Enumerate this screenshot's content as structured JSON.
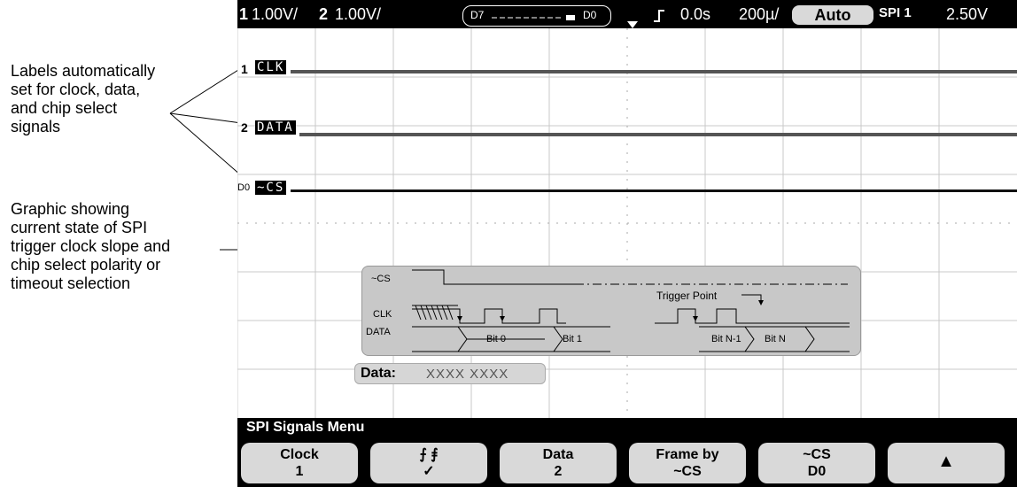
{
  "callouts": {
    "labels": [
      "Labels automatically",
      "set  for clock, data,",
      "and chip select",
      "signals"
    ],
    "graphic": [
      "Graphic showing",
      "current state of SPI",
      "trigger clock slope and",
      "chip select polarity or",
      "timeout selection"
    ]
  },
  "statusbar": {
    "ch1_num": "1",
    "ch1_scale": "1.00V/",
    "ch2_num": "2",
    "ch2_scale": "1.00V/",
    "digital_left": "D7",
    "digital_right": "D0",
    "trigger_glyph": "⨽",
    "delay": "0.0s",
    "timebase": "200µ/",
    "mode": "Auto",
    "trigger_source": "SPI 1",
    "trigger_level": "2.50V"
  },
  "traces": {
    "clk": {
      "marker": "1",
      "label": "CLK"
    },
    "data": {
      "marker": "2",
      "label": "DATA"
    },
    "cs": {
      "marker": "D0",
      "label": "~CS"
    }
  },
  "spi_graphic": {
    "cs_label": "~CS",
    "clk_label": "CLK",
    "data_label": "DATA",
    "trigger_point": "Trigger Point",
    "bits": [
      "Bit 0",
      "Bit 1",
      "Bit N-1",
      "Bit N"
    ]
  },
  "data_box": {
    "label": "Data:",
    "value": "XXXX XXXX"
  },
  "menu": {
    "title": "SPI Signals Menu",
    "softkeys": [
      {
        "line1": "Clock",
        "line2": "1"
      },
      {
        "line1": "⨍   ⨎",
        "line2": "✓"
      },
      {
        "line1": "Data",
        "line2": "2"
      },
      {
        "line1": "Frame by",
        "line2": "~CS"
      },
      {
        "line1": "~CS",
        "line2": "D0"
      },
      {
        "line1": "▲",
        "line2": ""
      }
    ]
  }
}
